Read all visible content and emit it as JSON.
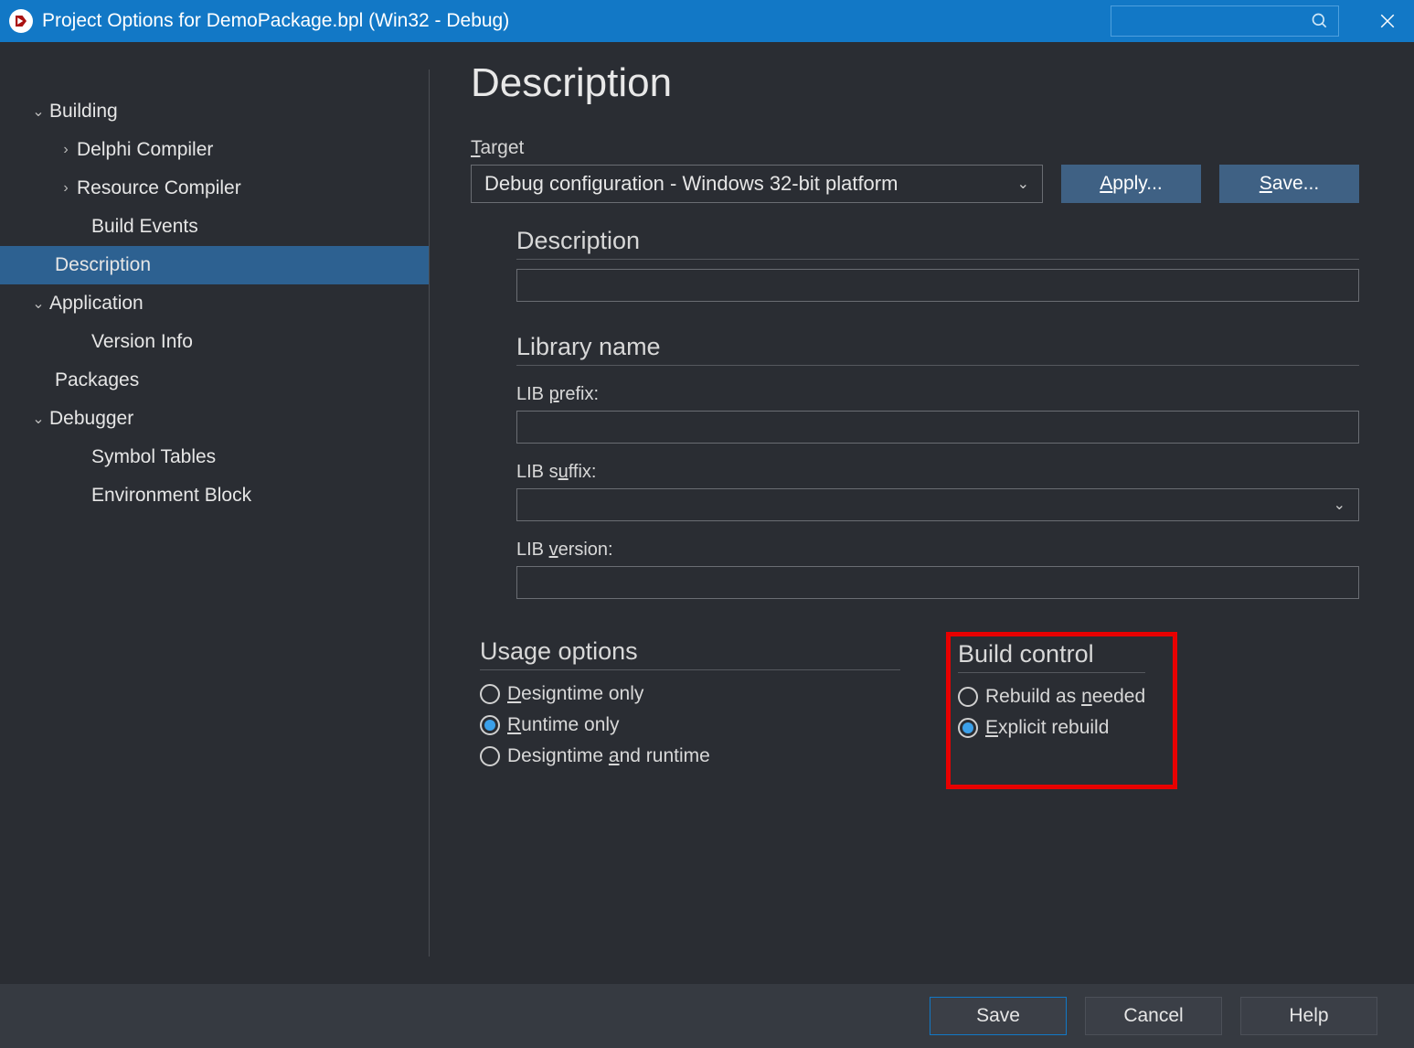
{
  "titlebar": {
    "title": "Project Options for DemoPackage.bpl  (Win32 - Debug)"
  },
  "sidebar": {
    "items": [
      {
        "label": "Building",
        "level": 0,
        "expanded": true
      },
      {
        "label": "Delphi Compiler",
        "level": 1,
        "hasChildren": true
      },
      {
        "label": "Resource Compiler",
        "level": 1,
        "hasChildren": true
      },
      {
        "label": "Build Events",
        "level": 1,
        "hasChildren": false
      },
      {
        "label": "Description",
        "level": 1,
        "hasChildren": false,
        "selected": true
      },
      {
        "label": "Application",
        "level": 0,
        "expanded": true
      },
      {
        "label": "Version Info",
        "level": 1,
        "hasChildren": false
      },
      {
        "label": "Packages",
        "level": 1,
        "hasChildren": false,
        "pull": true
      },
      {
        "label": "Debugger",
        "level": 0,
        "expanded": true
      },
      {
        "label": "Symbol Tables",
        "level": 1,
        "hasChildren": false
      },
      {
        "label": "Environment Block",
        "level": 1,
        "hasChildren": false
      }
    ]
  },
  "content": {
    "pageTitle": "Description",
    "targetLabel": "Target",
    "targetValue": "Debug configuration - Windows 32-bit platform",
    "applyLabel": "Apply...",
    "saveLabel": "Save...",
    "descHeading": "Description",
    "descValue": "",
    "libHeading": "Library name",
    "libPrefixLabel": "LIB prefix:",
    "libPrefixValue": "",
    "libSuffixLabel": "LIB suffix:",
    "libSuffixValue": "",
    "libVersionLabel": "LIB version:",
    "libVersionValue": "",
    "usageHeading": "Usage options",
    "usageOptions": [
      {
        "label": "Designtime only",
        "checked": false,
        "ul": "D"
      },
      {
        "label": "Runtime only",
        "checked": true,
        "ul": "R"
      },
      {
        "label": "Designtime and runtime",
        "checked": false,
        "ul": "a"
      }
    ],
    "buildHeading": "Build control",
    "buildOptions": [
      {
        "label": "Rebuild as needed",
        "checked": false,
        "ul": "n"
      },
      {
        "label": "Explicit rebuild",
        "checked": true,
        "ul": "E"
      }
    ]
  },
  "footer": {
    "save": "Save",
    "cancel": "Cancel",
    "help": "Help"
  }
}
